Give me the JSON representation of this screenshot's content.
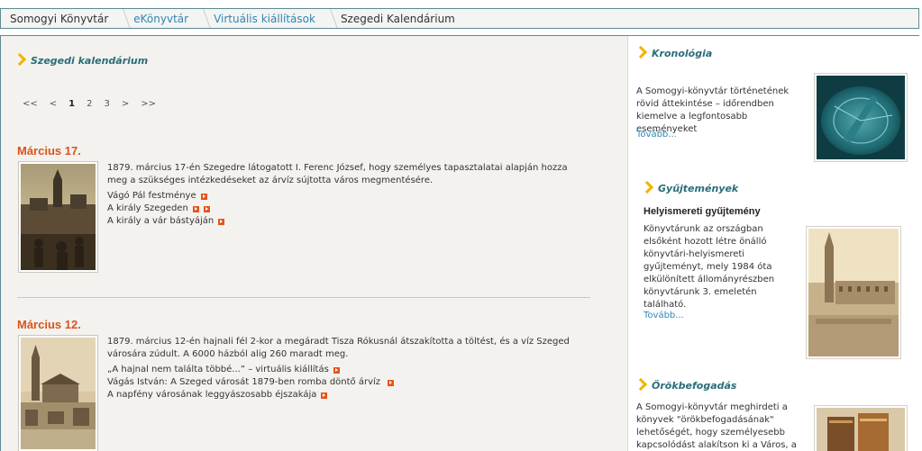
{
  "breadcrumb": [
    {
      "label": "Somogyi Könyvtár"
    },
    {
      "label": "eKönyvtár"
    },
    {
      "label": "Virtuális kiállítások"
    },
    {
      "label": "Szegedi Kalendárium"
    }
  ],
  "main": {
    "title": "Szegedi kalendárium",
    "pager": {
      "first": "<<",
      "prev": "<",
      "pages": [
        "1",
        "2",
        "3"
      ],
      "next": ">",
      "last": ">>",
      "current": "1"
    },
    "entries": [
      {
        "date": "Március 17.",
        "text": "1879. március 17-én Szegedre látogatott I. Ferenc József, hogy személyes tapasztalatai alapján hozza meg a szükséges intézkedéseket az árvíz sújtotta város megmentésére.",
        "links": [
          "Vágó Pál festménye",
          "A király Szegeden",
          "A király a vár bástyáján"
        ]
      },
      {
        "date": "Március 12.",
        "text": "1879. március 12-én hajnali fél 2-kor a megáradt Tisza Rókusnál átszakította a töltést, és a víz Szeged városára zúdult. A 6000 házból alig 260 maradt meg.",
        "links": [
          "„A hajnal nem találta többé...” – virtuális kiállítás",
          "Vágás István: A Szeged városát 1879-ben romba döntő árvíz",
          "A napfény városának leggyászosabb éjszakája"
        ]
      }
    ]
  },
  "sidebar": {
    "chronology": {
      "title": "Kronológia",
      "text": "A Somogyi-könyvtár történetének rövid áttekintése – időrendben kiemelve a legfontosabb eseményeket",
      "more": "Tovább..."
    },
    "collections": {
      "title": "Gyűjtemények",
      "subtitle": "Helyismereti gyűjtemény",
      "text": "Könyvtárunk az országban elsőként hozott létre önálló könyvtári-helyismereti gyűjteményt, mely 1984 óta elkülönített állományrészben könyvtárunk 3. emeletén található.",
      "more": "Tovább..."
    },
    "adoption": {
      "title": "Örökbefogadás",
      "text": "A Somogyi-könyvtár meghirdeti a könyvek \"örökbefogadásának\" lehetőségét, hogy személyesebb kapcsolódást alakítson ki a Város, a Város"
    }
  },
  "colors": {
    "accent": "#2a6d7a",
    "date": "#d9531e",
    "link": "#2f86b6",
    "chevron": "#f2b300"
  }
}
